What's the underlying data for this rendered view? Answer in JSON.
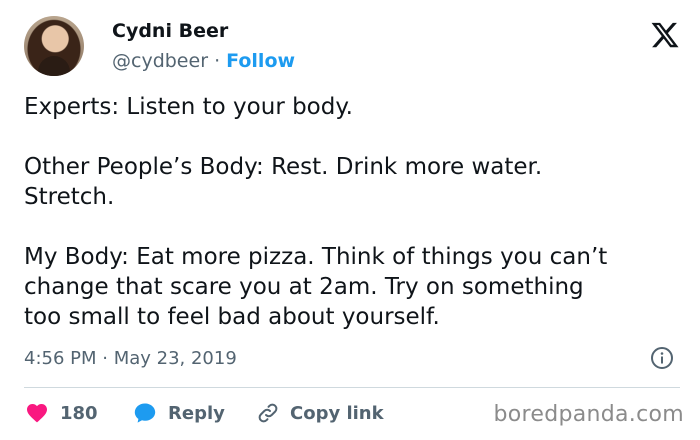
{
  "author": {
    "name": "Cydni Beer",
    "handle": "@cydbeer",
    "separator": "·",
    "follow_label": "Follow"
  },
  "brand": {
    "icon": "x-logo-icon",
    "color": "#0f1419"
  },
  "tweet": {
    "text": "Experts: Listen to your body.\n\nOther People’s Body: Rest. Drink more water.\nStretch.\n\nMy Body: Eat more pizza. Think of things you can’t\nchange that scare you at 2am. Try on something\ntoo small to feel bad about yourself.",
    "timestamp": "4:56 PM · May 23, 2019"
  },
  "actions": {
    "like": {
      "icon": "heart-icon",
      "count": "180",
      "color": "#f91880"
    },
    "reply": {
      "icon": "speech-bubble-icon",
      "label": "Reply",
      "color": "#1d9bf0"
    },
    "copy": {
      "icon": "link-icon",
      "label": "Copy link"
    }
  },
  "info": {
    "icon": "info-icon"
  },
  "watermark": {
    "text": "boredpanda.com"
  },
  "colors": {
    "accent": "#1d9bf0",
    "muted": "#536471",
    "divider": "#cfd9de",
    "text": "#0f1419"
  }
}
